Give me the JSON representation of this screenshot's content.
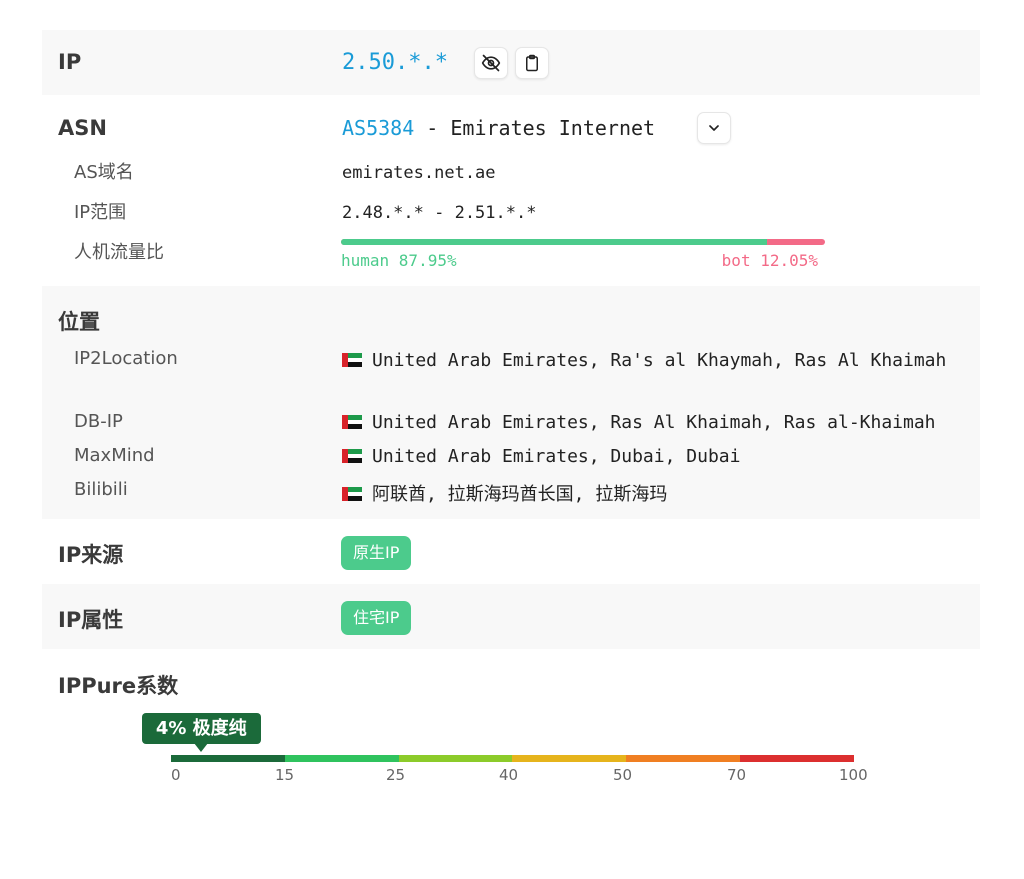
{
  "ip": {
    "label": "IP",
    "value": "2.50.*.*"
  },
  "asn": {
    "label": "ASN",
    "number": "AS5384",
    "separator": " - ",
    "name": "Emirates Internet",
    "domain_label": "AS域名",
    "domain_value": "emirates.net.ae",
    "range_label": "IP范围",
    "range_value": "2.48.*.* - 2.51.*.*",
    "traffic_label": "人机流量比",
    "human_text": "human 87.95%",
    "bot_text": "bot 12.05%",
    "human_fraction": 0.8795
  },
  "location": {
    "label": "位置",
    "rows": [
      {
        "source": "IP2Location",
        "text": "United Arab Emirates, Ra's al Khaymah, Ras Al Khaimah"
      },
      {
        "source": "DB-IP",
        "text": "United Arab Emirates, Ras Al Khaimah, Ras al-Khaimah"
      },
      {
        "source": "MaxMind",
        "text": "United Arab Emirates, Dubai, Dubai"
      },
      {
        "source": "Bilibili",
        "text": "阿联酋, 拉斯海玛酋长国, 拉斯海玛"
      }
    ]
  },
  "source": {
    "label": "IP来源",
    "badge": "原生IP"
  },
  "attribute": {
    "label": "IP属性",
    "badge": "住宅IP"
  },
  "purity": {
    "label": "IPPure系数",
    "indicator": "4% 极度纯",
    "value_percent": 4,
    "scale_ticks": [
      "0",
      "15",
      "25",
      "40",
      "50",
      "70",
      "100"
    ]
  },
  "colors": {
    "link": "#1a9bd7",
    "human": "#4ccb8c",
    "bot": "#f36a87",
    "badge": "#4ccb8c",
    "indicator": "#1b6a3a",
    "scale": [
      "#1b6a3a",
      "#2fc35e",
      "#8ccb2a",
      "#e6b41c",
      "#f07f22",
      "#dc2f2f"
    ]
  },
  "icons": {
    "hide": "eye-off-icon",
    "copy": "clipboard-icon",
    "expand": "chevron-down-icon",
    "flag": "uae-flag-icon"
  }
}
